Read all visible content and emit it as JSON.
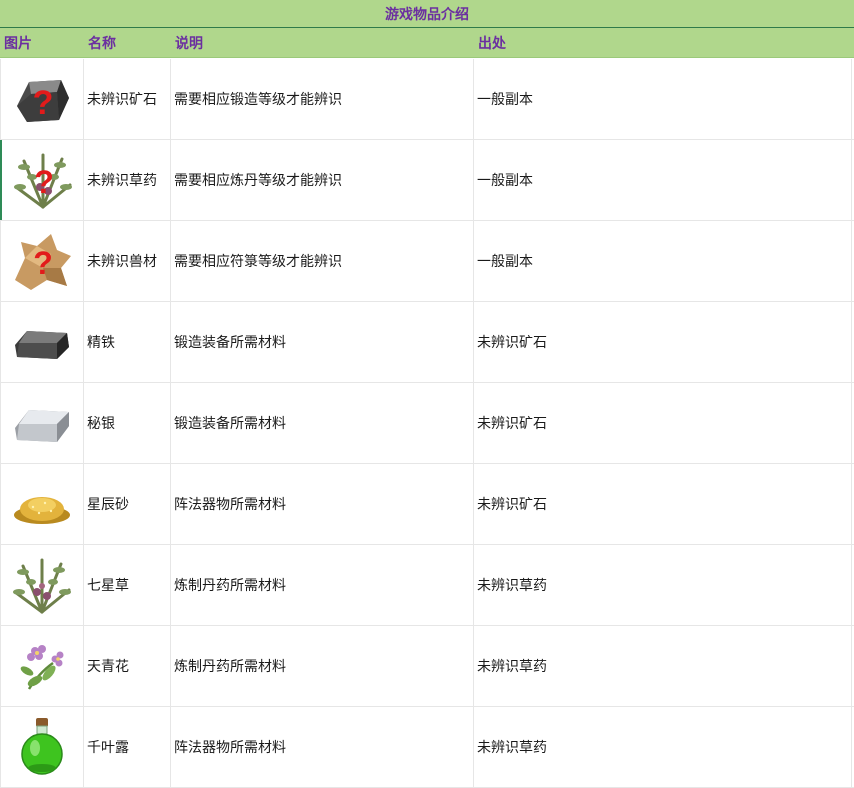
{
  "title": "游戏物品介绍",
  "headers": {
    "image": "图片",
    "name": "名称",
    "desc": "说明",
    "source": "出处"
  },
  "rows": [
    {
      "icon": "unknown-ore-icon",
      "name": "未辨识矿石",
      "desc": "需要相应锻造等级才能辨识",
      "source": "一般副本"
    },
    {
      "icon": "unknown-herb-icon",
      "name": "未辨识草药",
      "desc": "需要相应炼丹等级才能辨识",
      "source": "一般副本"
    },
    {
      "icon": "unknown-beast-material-icon",
      "name": "未辨识兽材",
      "desc": "需要相应符箓等级才能辨识",
      "source": "一般副本"
    },
    {
      "icon": "iron-ingot-icon",
      "name": "精铁",
      "desc": "锻造装备所需材料",
      "source": "未辨识矿石"
    },
    {
      "icon": "silver-ingot-icon",
      "name": "秘银",
      "desc": "锻造装备所需材料",
      "source": "未辨识矿石"
    },
    {
      "icon": "star-sand-icon",
      "name": "星辰砂",
      "desc": "阵法器物所需材料",
      "source": "未辨识矿石"
    },
    {
      "icon": "herb-bundle-icon",
      "name": "七星草",
      "desc": "炼制丹药所需材料",
      "source": "未辨识草药"
    },
    {
      "icon": "purple-flower-icon",
      "name": "天青花",
      "desc": "炼制丹药所需材料",
      "source": "未辨识草药"
    },
    {
      "icon": "green-potion-icon",
      "name": "千叶露",
      "desc": "阵法器物所需材料",
      "source": "未辨识草药"
    }
  ],
  "colors": {
    "header_bg": "#b0d78c",
    "header_text": "#6b2fa0",
    "selected_border": "#2e8b57"
  }
}
